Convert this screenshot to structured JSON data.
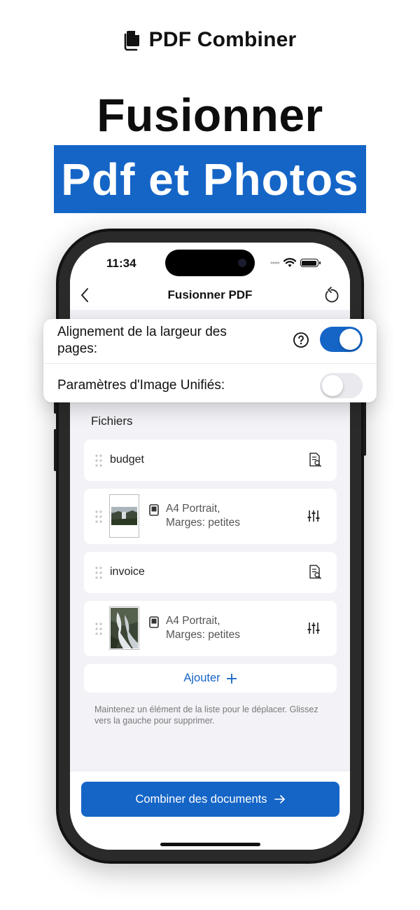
{
  "brand": {
    "name": "PDF Combiner",
    "icon": "document-stack-icon"
  },
  "headline": {
    "line1": "Fusionner",
    "line2": "Pdf et Photos"
  },
  "colors": {
    "accent": "#1565c7",
    "toggle_off": "#e9e9ee",
    "screen_bg": "#f2f2f7"
  },
  "status_bar": {
    "time": "11:34",
    "signal": "••••",
    "icons": [
      "wifi-icon",
      "battery-icon"
    ]
  },
  "nav": {
    "title": "Fusionner PDF",
    "back_icon": "chevron-left-icon",
    "right_icon": "reset-icon"
  },
  "options": {
    "width_alignment": {
      "label": "Alignement de la largeur des pages:",
      "enabled": true
    },
    "unified_image": {
      "label": "Paramètres d'Image Unifiés:",
      "enabled": false
    }
  },
  "files": {
    "title": "Fichiers",
    "items": [
      {
        "type": "pdf",
        "name": "budget"
      },
      {
        "type": "image",
        "line1": "A4 Portrait,",
        "line2": "Marges: petites"
      },
      {
        "type": "pdf",
        "name": "invoice"
      },
      {
        "type": "image",
        "line1": "A4 Portrait,",
        "line2": "Marges: petites"
      }
    ],
    "add_label": "Ajouter",
    "hint": "Maintenez un élément de la liste pour le déplacer. Glissez vers la gauche pour supprimer."
  },
  "combine_button": {
    "label": "Combiner des documents"
  }
}
